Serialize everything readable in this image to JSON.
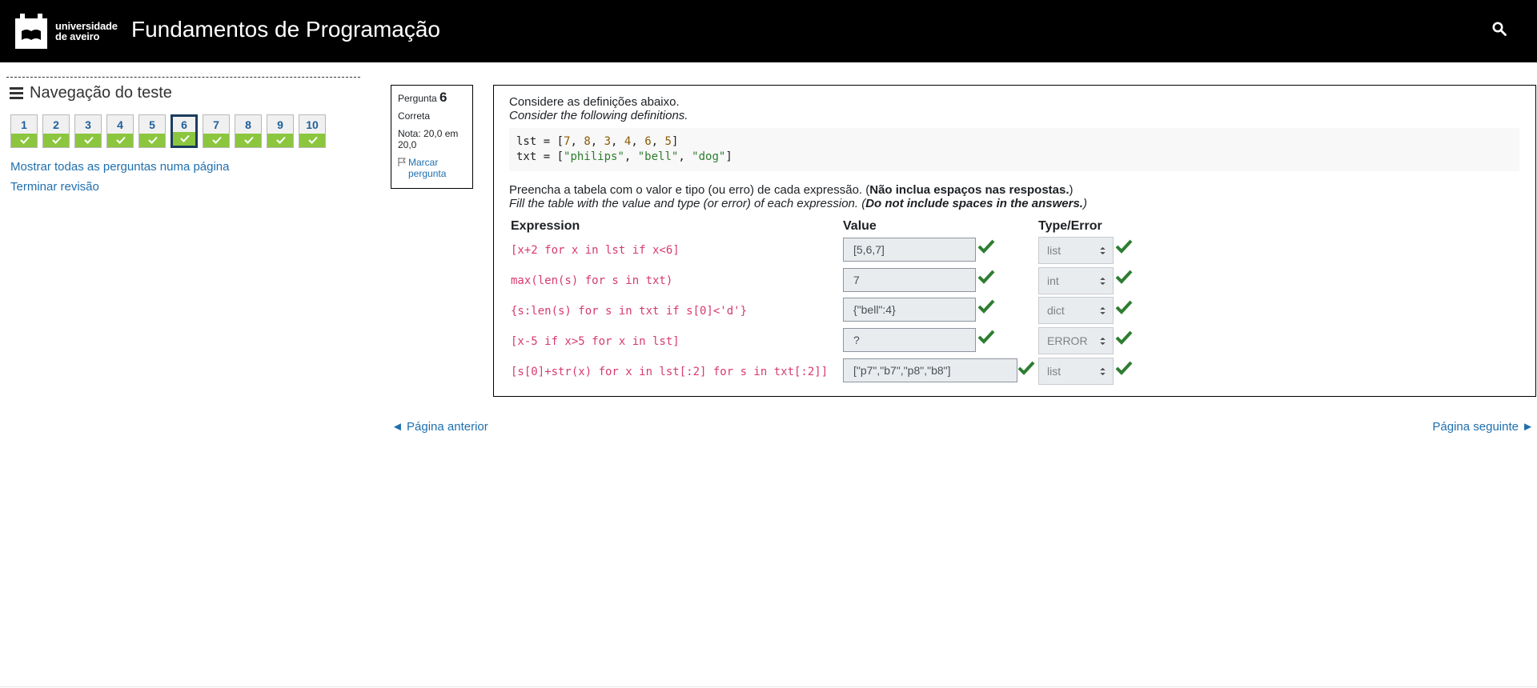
{
  "header": {
    "logo_line1": "universidade",
    "logo_line2": "de aveiro",
    "site_title": "Fundamentos de Programação",
    "icon": "search-icon"
  },
  "quiz_nav": {
    "title": "Navegação do teste",
    "questions": [
      "1",
      "2",
      "3",
      "4",
      "5",
      "6",
      "7",
      "8",
      "9",
      "10"
    ],
    "current": "6",
    "status_color": "#8cc63f",
    "show_all_link": "Mostrar todas as perguntas numa página",
    "finish_link": "Terminar revisão"
  },
  "question_info": {
    "label": "Pergunta",
    "number": "6",
    "state": "Correta",
    "grade_line1": "Nota: 20,0 em",
    "grade_line2": "20,0",
    "flag_line1": "Marcar",
    "flag_line2": "pergunta"
  },
  "question": {
    "intro_pt": "Considere as definições abaixo.",
    "intro_en": "Consider the following definitions.",
    "code": {
      "line1": {
        "name": "lst",
        "values": [
          "7",
          "8",
          "3",
          "4",
          "6",
          "5"
        ]
      },
      "line2": {
        "name": "txt",
        "values": [
          "\"philips\"",
          "\"bell\"",
          "\"dog\""
        ]
      }
    },
    "instr_pt_a": "Preencha a tabela com o valor e tipo (ou erro) de cada expressão. (",
    "instr_pt_b": "Não inclua espaços nas respostas.",
    "instr_pt_c": ")",
    "instr_en_a": "Fill the table with the value and type (or error) of each expression. (",
    "instr_en_b": "Do not include spaces in the answers.",
    "instr_en_c": ")",
    "columns": [
      "Expression",
      "Value",
      "Type/Error"
    ],
    "rows": [
      {
        "expression": "[x+2 for x in lst if x<6]",
        "value": "[5,6,7]",
        "type": "list"
      },
      {
        "expression": "max(len(s) for s in txt)",
        "value": "7",
        "type": "int"
      },
      {
        "expression": "{s:len(s) for s in txt if s[0]<'d'}",
        "value": "{\"bell\":4}",
        "type": "dict"
      },
      {
        "expression": "[x-5 if x>5 for x in lst]",
        "value": "?",
        "type": "ERROR"
      },
      {
        "expression": "[s[0]+str(x) for x in lst[:2] for s in txt[:2]]",
        "value": "[\"p7\",\"b7\",\"p8\",\"b8\"]",
        "type": "list"
      }
    ],
    "correct_color": "#2e7d32"
  },
  "pagination": {
    "prev": "◄ Página anterior",
    "next": "Página seguinte ►"
  }
}
